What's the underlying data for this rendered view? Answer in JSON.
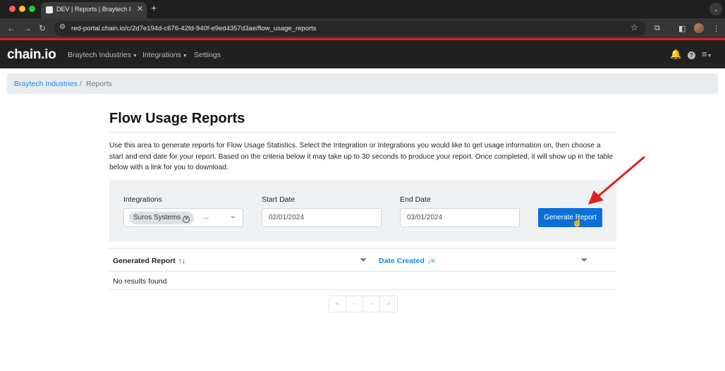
{
  "browser": {
    "tab_title": "DEV | Reports | Braytech Indu",
    "url": "red-portal.chain.io/c/2d7e194d-c676-42fd-940f-e9ed4357d3ae/flow_usage_reports"
  },
  "nav": {
    "logo": "chain.io",
    "items": [
      {
        "label": "Braytech Industries",
        "has_caret": true
      },
      {
        "label": "Integrations",
        "has_caret": true
      },
      {
        "label": "Settings",
        "has_caret": false
      }
    ]
  },
  "breadcrumb": {
    "parent": "Braytech Industries",
    "separator": "/",
    "current": "Reports"
  },
  "page": {
    "title": "Flow Usage Reports",
    "description": "Use this area to generate reports for Flow Usage Statistics. Select the Integration or Integrations you would like to get usage information on, then choose a start and end date for your report. Based on the criteria below it may take up to 30 seconds to produce your report. Once completed, it will show up in the table below with a link for you to download."
  },
  "filters": {
    "integrations_label": "Integrations",
    "integrations_selected": "Suros Systems",
    "integrations_more": "...",
    "start_label": "Start Date",
    "start_value": "02/01/2024",
    "end_label": "End Date",
    "end_value": "03/01/2024",
    "generate_button": "Generate Report"
  },
  "table": {
    "columns": [
      "Generated Report",
      "Date Created"
    ],
    "empty_text": "No results found"
  },
  "pager": {
    "buttons": [
      "«",
      "‹",
      "›",
      "»"
    ]
  },
  "colors": {
    "accent": "#0b6fd6",
    "link": "#1e88e5",
    "navbar": "#212121",
    "brand_red": "#e0201c",
    "annotation": "#e02020"
  }
}
